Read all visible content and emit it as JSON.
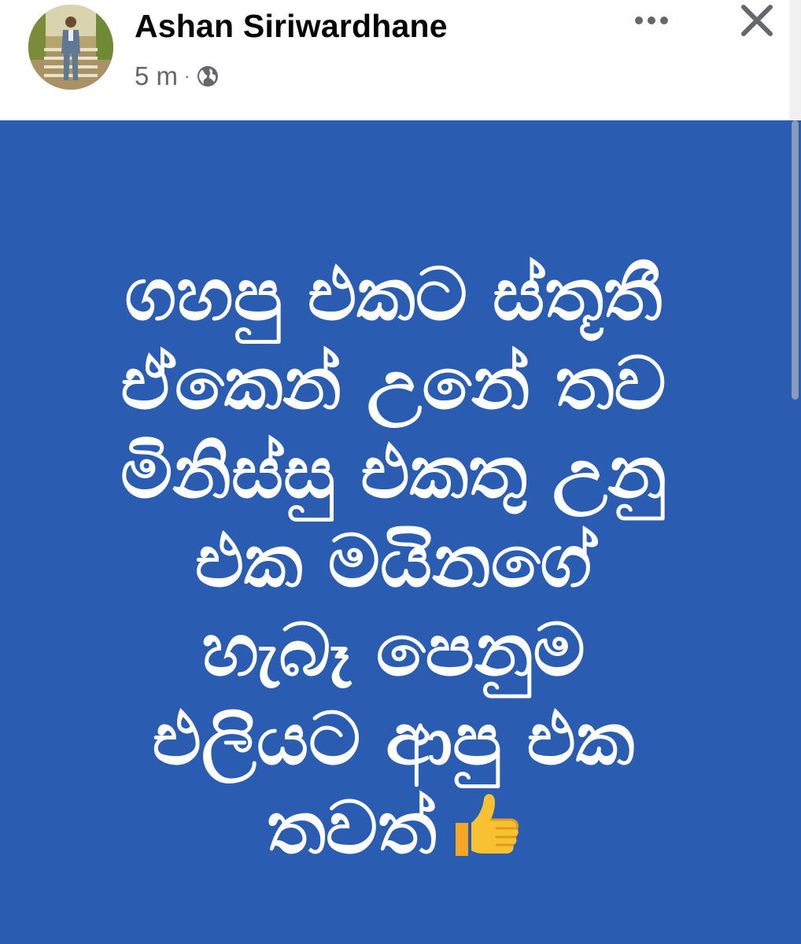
{
  "post": {
    "author": "Ashan Siriwardhane",
    "timestamp": "5 m",
    "separator": "·",
    "privacy_icon": "globe-icon",
    "menu_icon": "more-dots-icon",
    "close_icon": "close-icon",
    "background_color": "#2a5cb2",
    "text_color": "#ffffff",
    "text_lines": [
      "ගහපු එකට ස්තූතී",
      "ඒකෙන් උනේ තව",
      "මිනිස්සු එකතු උනු",
      "එක මයිනගේ",
      "හැබෑ පෙනුම",
      "එලියට ආපු එක",
      "තවත්"
    ],
    "trailing_emoji": "thumbs-up-icon"
  }
}
